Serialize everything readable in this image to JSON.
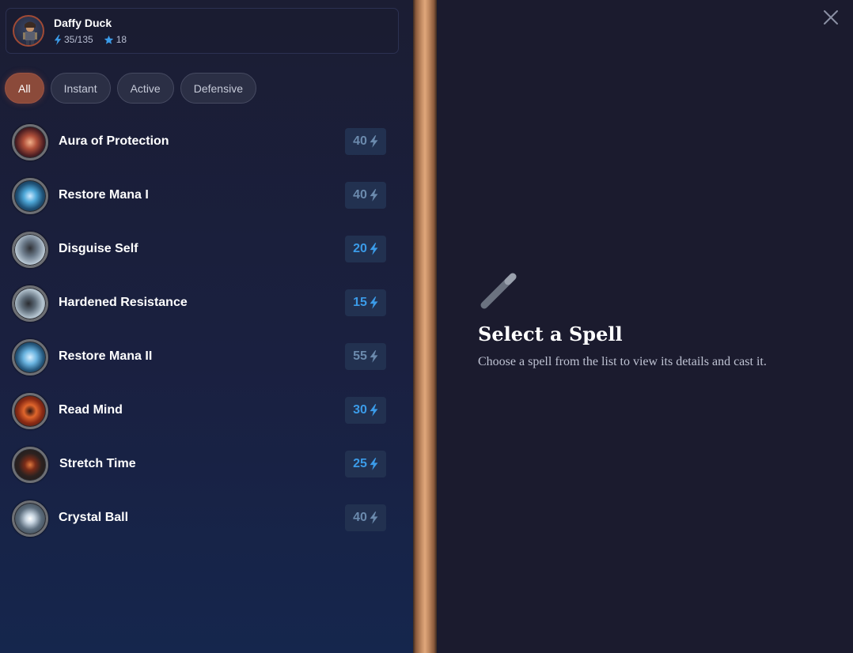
{
  "player": {
    "name": "Daffy Duck",
    "energy": "35/135",
    "stars": "18",
    "avatar_icon": "character-portrait-icon"
  },
  "filters": [
    {
      "label": "All",
      "active": true
    },
    {
      "label": "Instant",
      "active": false
    },
    {
      "label": "Active",
      "active": false
    },
    {
      "label": "Defensive",
      "active": false
    }
  ],
  "spells": [
    {
      "name": "Aura of Protection",
      "cost": "40",
      "icon": "aura-orb-icon",
      "affordable": false
    },
    {
      "name": "Restore Mana I",
      "cost": "40",
      "icon": "mana-orb-icon",
      "affordable": false
    },
    {
      "name": "Disguise Self",
      "cost": "20",
      "icon": "hooded-figure-icon",
      "affordable": true
    },
    {
      "name": "Hardened Resistance",
      "cost": "15",
      "icon": "shield-swirl-icon",
      "affordable": true
    },
    {
      "name": "Restore Mana II",
      "cost": "55",
      "icon": "mana-orb-icon",
      "affordable": false
    },
    {
      "name": "Read Mind",
      "cost": "30",
      "icon": "fire-triangle-icon",
      "affordable": true
    },
    {
      "name": "Stretch Time",
      "cost": "25",
      "icon": "hourglass-icon",
      "affordable": true
    },
    {
      "name": "Crystal Ball",
      "cost": "40",
      "icon": "crystal-ball-icon",
      "affordable": false
    }
  ],
  "detail": {
    "title": "Select a Spell",
    "description": "Choose a spell from the list to view its details and cast it.",
    "icon": "wand-icon"
  },
  "colors": {
    "affordable_cost": "#3b9be8",
    "unaffordable_cost": "#6b8aad",
    "accent": "#8b4a3a",
    "energy": "#3b9be8"
  }
}
